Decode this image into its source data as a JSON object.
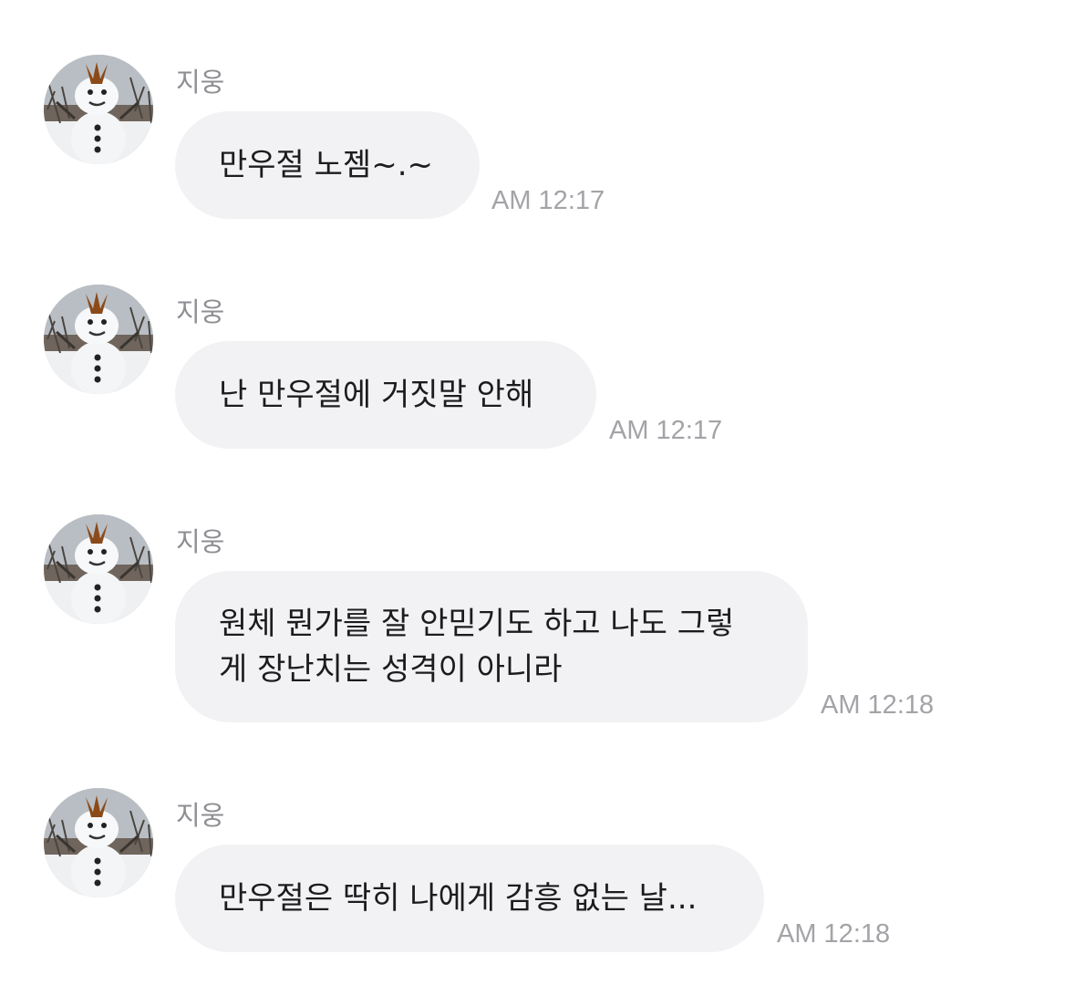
{
  "messages": [
    {
      "sender": "지웅",
      "text": "만우절 노젬~.~",
      "time": "AM 12:17"
    },
    {
      "sender": "지웅",
      "text": "난 만우절에 거짓말 안해",
      "time": "AM 12:17"
    },
    {
      "sender": "지웅",
      "text": "원체 뭔가를 잘 안믿기도 하고 나도 그렇\n게 장난치는 성격이 아니라",
      "time": "AM 12:18"
    },
    {
      "sender": "지웅",
      "text": "만우절은 딱히 나에게 감흥 없는 날...",
      "time": "AM 12:18"
    }
  ],
  "avatar_icon": "snowman-avatar",
  "colors": {
    "bubble": "#f2f2f5",
    "text": "#1c1c1e",
    "sender": "#8e8e93",
    "time": "#a3a3a8"
  }
}
